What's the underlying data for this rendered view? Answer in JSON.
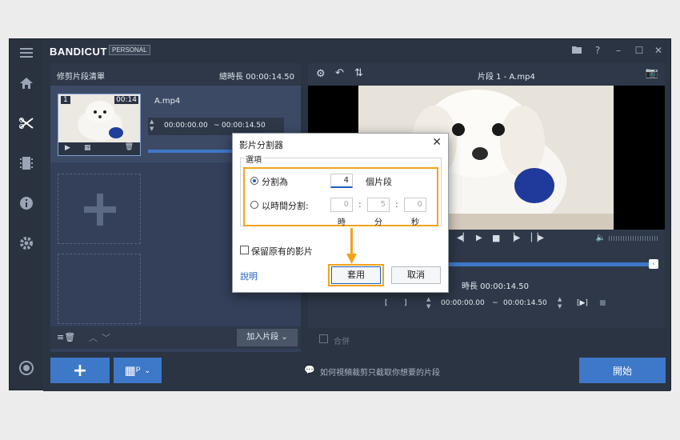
{
  "app": {
    "logo": "BANDICUT",
    "edition": "PERSONAL"
  },
  "titlebar": {
    "folder_icon": "folder-icon",
    "help": "?",
    "minimize": "–",
    "maximize": "☐",
    "close": "✕"
  },
  "sidebar": {
    "items": [
      "menu-icon",
      "home-icon",
      "cut-icon",
      "film-icon",
      "info-icon",
      "gear-icon",
      "record-icon"
    ]
  },
  "clip_list": {
    "title": "修剪片段清單",
    "total_duration": "總時長 00:00:14.50",
    "clip": {
      "index": "1",
      "duration": "00:14",
      "filename": "A.mp4",
      "range_start": "00:00:00.00",
      "range_sep": "~",
      "range_end": "00:00:14.50"
    },
    "add_clip": "加入片段"
  },
  "preview": {
    "title": "片段 1 - A.mp4",
    "duration_label": "時長 00:00:14.50",
    "range_start": "00:00:00.00",
    "range_sep": "~",
    "range_end": "00:00:14.50",
    "merge_label": "合併",
    "bracket_open": "[",
    "bracket_close": "]",
    "marker": "[▶]"
  },
  "bottom": {
    "hint": "如何視頻裁剪只截取你想要的片段",
    "start_button": "開始"
  },
  "dialog": {
    "title": "影片分割器",
    "close": "✕",
    "options_label": "選項",
    "split_into_label": "分割為",
    "split_into_value": "4",
    "split_into_unit": "個片段",
    "split_by_time_label": "以時間分割:",
    "hours_value": "0",
    "minutes_value": "5",
    "seconds_value": "0",
    "colon": ":",
    "hours_unit": "時",
    "minutes_unit": "分",
    "seconds_unit": "秒",
    "keep_original_label": "保留原有的影片",
    "help_link": "說明",
    "apply_button": "套用",
    "cancel_button": "取消"
  },
  "colors": {
    "accent": "#3e78c8",
    "highlight": "#f5a21a",
    "bg": "#2b3443"
  }
}
